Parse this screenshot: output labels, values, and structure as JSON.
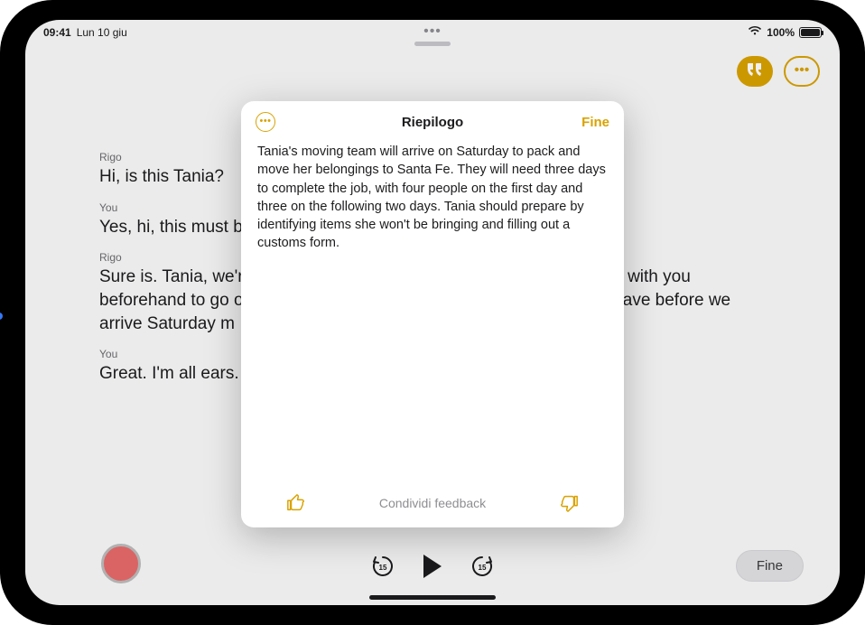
{
  "statusbar": {
    "time": "09:41",
    "date": "Lun 10 giu",
    "battery_pct": "100%"
  },
  "topright": {
    "transcript_icon": "quote-icon",
    "more_icon": "ellipsis-circle-icon"
  },
  "transcript": [
    {
      "speaker": "Rigo",
      "text": "Hi, is this Tania?"
    },
    {
      "speaker": "You",
      "text": "Yes, hi, this must be I"
    },
    {
      "speaker": "Rigo",
      "text": "Sure is. Tania, we're c                                                                 o chat with you beforehand to go ove                                                             u might have before we arrive Saturday m"
    },
    {
      "speaker": "You",
      "text": "Great. I'm all ears."
    }
  ],
  "bottom": {
    "done_label": "Fine"
  },
  "modal": {
    "title": "Riepilogo",
    "done_label": "Fine",
    "body": "Tania's moving team will arrive on Saturday to pack and move her belongings to Santa Fe. They will need three days to complete the job, with four people on the first day and three on the following two days. Tania should prepare by identifying items she won't be bringing and filling out a customs form.",
    "feedback_label": "Condividi feedback"
  }
}
